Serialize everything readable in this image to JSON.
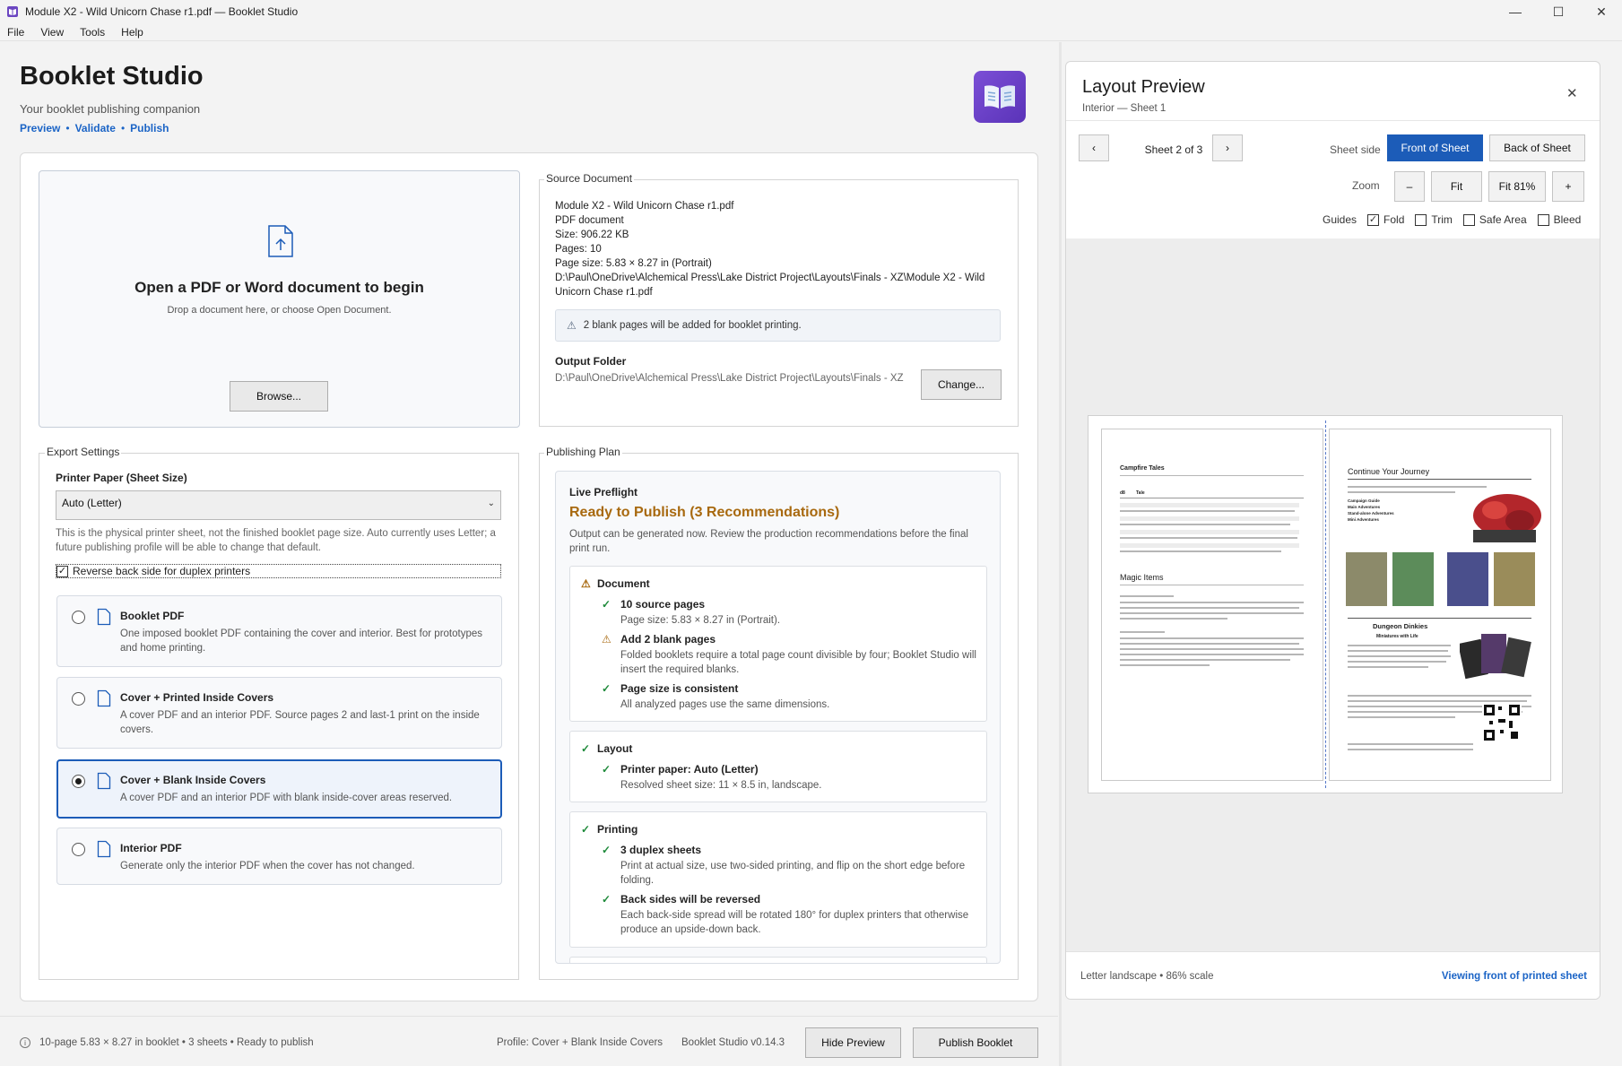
{
  "window": {
    "title": "Module X2 - Wild Unicorn Chase r1.pdf — Booklet Studio",
    "controls": {
      "minimize": "—",
      "maximize": "☐",
      "close": "✕"
    }
  },
  "menu": [
    "File",
    "View",
    "Tools",
    "Help"
  ],
  "header": {
    "title": "Booklet Studio",
    "subtitle": "Your booklet publishing companion",
    "links": [
      "Preview",
      "Validate",
      "Publish"
    ],
    "link_sep": "•"
  },
  "drop_zone": {
    "title": "Open a PDF or Word document to begin",
    "hint": "Drop a document here, or choose Open Document.",
    "browse_label": "Browse..."
  },
  "source": {
    "group_label": "Source Document",
    "lines": [
      "Module X2 - Wild Unicorn Chase r1.pdf",
      "PDF document",
      "Size: 906.22 KB",
      "Pages: 10",
      "Page size: 5.83 × 8.27 in (Portrait)",
      "D:\\Paul\\OneDrive\\Alchemical Press\\Lake District Project\\Layouts\\Finals - XZ\\Module X2 - Wild Unicorn Chase r1.pdf"
    ],
    "notice": "2 blank pages will be added for booklet printing.",
    "output_label": "Output Folder",
    "output_path": "D:\\Paul\\OneDrive\\Alchemical Press\\Lake District Project\\Layouts\\Finals - XZ",
    "change_label": "Change..."
  },
  "export": {
    "group_label": "Export Settings",
    "paper_label": "Printer Paper (Sheet Size)",
    "paper_value": "Auto (Letter)",
    "paper_help": "This is the physical printer sheet, not the finished booklet page size. Auto currently uses Letter; a future publishing profile will be able to change that default.",
    "reverse_label": "Reverse back side for duplex printers",
    "reverse_checked": true,
    "options": [
      {
        "title": "Booklet PDF",
        "desc": "One imposed booklet PDF containing the cover and interior. Best for prototypes and home printing.",
        "selected": false
      },
      {
        "title": "Cover + Printed Inside Covers",
        "desc": "A cover PDF and an interior PDF. Source pages 2 and last-1 print on the inside covers.",
        "selected": false
      },
      {
        "title": "Cover + Blank Inside Covers",
        "desc": "A cover PDF and an interior PDF with blank inside-cover areas reserved.",
        "selected": true
      },
      {
        "title": "Interior PDF",
        "desc": "Generate only the interior PDF when the cover has not changed.",
        "selected": false
      }
    ]
  },
  "plan": {
    "group_label": "Publishing Plan",
    "kicker": "Live Preflight",
    "status": "Ready to Publish (3 Recommendations)",
    "desc": "Output can be generated now. Review the production recommendations before the final print run.",
    "sections": [
      {
        "title": "Document",
        "status": "warning",
        "items": [
          {
            "status": "ok",
            "title": "10 source pages",
            "desc": "Page size: 5.83 × 8.27 in (Portrait)."
          },
          {
            "status": "warning",
            "title": "Add 2 blank pages",
            "desc": "Folded booklets require a total page count divisible by four; Booklet Studio will insert the required blanks."
          },
          {
            "status": "ok",
            "title": "Page size is consistent",
            "desc": "All analyzed pages use the same dimensions."
          }
        ]
      },
      {
        "title": "Layout",
        "status": "ok",
        "items": [
          {
            "status": "ok",
            "title": "Printer paper: Auto (Letter)",
            "desc": "Resolved sheet size: 11 × 8.5 in, landscape."
          }
        ]
      },
      {
        "title": "Printing",
        "status": "ok",
        "items": [
          {
            "status": "ok",
            "title": "3 duplex sheets",
            "desc": "Print at actual size, use two-sided printing, and flip on the short edge before folding."
          },
          {
            "status": "ok",
            "title": "Back sides will be reversed",
            "desc": "Each back-side spread will be rotated 180° for duplex printers that otherwise produce an upside-down back."
          }
        ]
      }
    ]
  },
  "statusbar": {
    "info": "10-page 5.83 × 8.27 in booklet • 3 sheets • Ready to publish",
    "profile": "Profile: Cover + Blank Inside Covers",
    "version": "Booklet Studio v0.14.3",
    "hide_preview": "Hide Preview",
    "publish": "Publish Booklet"
  },
  "preview": {
    "title": "Layout Preview",
    "subtitle": "Interior — Sheet 1",
    "sheet_label": "Sheet 2 of 3",
    "side_label": "Sheet side",
    "front_label": "Front of Sheet",
    "back_label": "Back of Sheet",
    "zoom_label": "Zoom",
    "zoom_out": "–",
    "fit": "Fit",
    "fit_pct": "Fit 81%",
    "zoom_in": "+",
    "guides_label": "Guides",
    "guides": [
      {
        "label": "Fold",
        "checked": true
      },
      {
        "label": "Trim",
        "checked": false
      },
      {
        "label": "Safe Area",
        "checked": false
      },
      {
        "label": "Bleed",
        "checked": false
      }
    ],
    "left_page": {
      "heading1": "Campfire Tales",
      "table_header": [
        "d8",
        "Tale"
      ],
      "heading2": "Magic Items"
    },
    "right_page": {
      "heading1": "Continue Your Journey",
      "bullets": [
        "Campaign Guide",
        "Main Adventures",
        "Stand-alone Adventures",
        "Mini Adventures"
      ],
      "heading2": "Dungeon Dinkies",
      "subheading2": "Miniatures with Life"
    },
    "footer_left": "Letter landscape • 86% scale",
    "footer_right": "Viewing front of printed sheet"
  }
}
